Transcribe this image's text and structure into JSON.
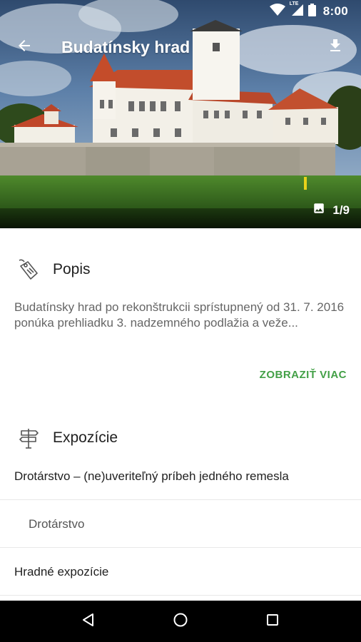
{
  "status": {
    "time": "8:00",
    "network": "LTE"
  },
  "toolbar": {
    "title": "Budatínsky hrad"
  },
  "gallery": {
    "counter": "1/9"
  },
  "description": {
    "heading": "Popis",
    "text": "Budatínsky hrad po rekonštrukcii sprístupnený od 31. 7. 2016 ponúka prehliadku 3. nadzemného podlažia a veže...",
    "more_label": "ZOBRAZIŤ VIAC",
    "accent": "#43a047"
  },
  "expositions": {
    "heading": "Expozície",
    "items": [
      {
        "label": "Drotárstvo – (ne)uveriteľný príbeh jedného remesla"
      },
      {
        "label": "Drotárstvo"
      },
      {
        "label": "Hradné expozície"
      }
    ]
  },
  "icons": {
    "back": "arrow-left-icon",
    "download": "download-icon",
    "photo": "image-icon",
    "description": "tag-icon",
    "expositions": "signpost-icon"
  }
}
